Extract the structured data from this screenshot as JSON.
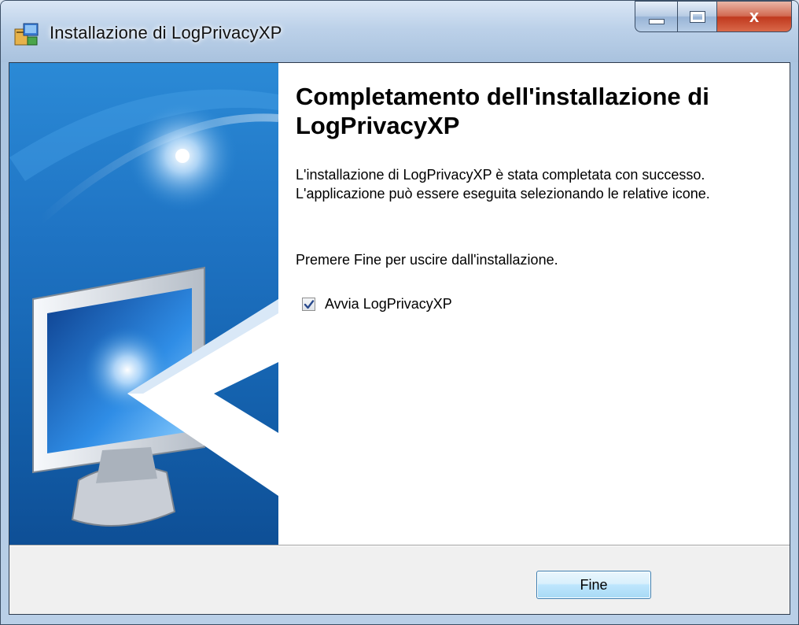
{
  "window": {
    "title": "Installazione di LogPrivacyXP",
    "close_glyph": "x",
    "accent_color": "#1f74c4",
    "icons": {
      "app": "installer-package-icon",
      "minimize": "minimize-icon",
      "maximize": "maximize-icon",
      "close": "close-icon"
    }
  },
  "wizard": {
    "heading": "Completamento dell'installazione di LogPrivacyXP",
    "paragraph1": "L'installazione di LogPrivacyXP è stata completata con successo. L'applicazione può essere eseguita selezionando le relative icone.",
    "paragraph2": "Premere Fine per uscire dall'installazione.",
    "checkbox": {
      "label": "Avvia LogPrivacyXP",
      "checked": true,
      "icon": "checkmark-icon"
    },
    "side_image": "computer-monitor-illustration"
  },
  "footer": {
    "finish_label": "Fine"
  }
}
